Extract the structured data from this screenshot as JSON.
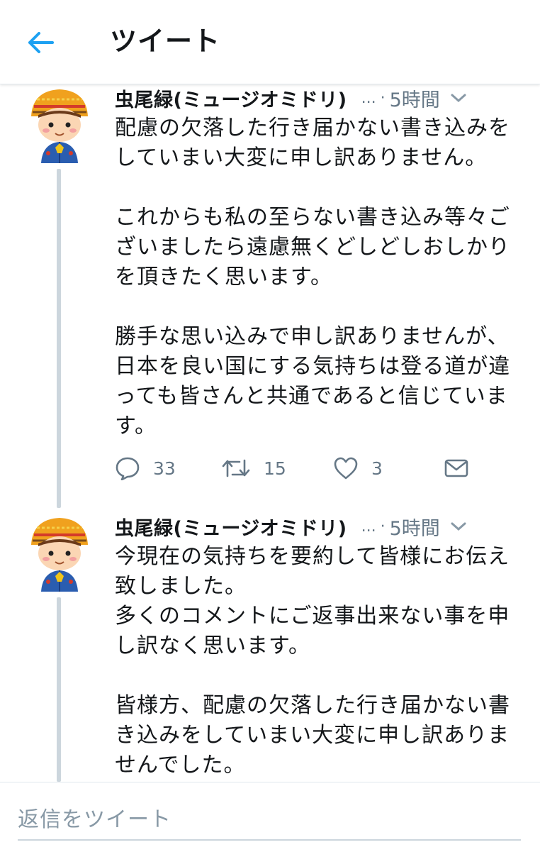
{
  "header": {
    "title": "ツイート"
  },
  "tweets": [
    {
      "author": "虫尾緑(ミュージオミドリ)",
      "ellipsis": "...",
      "separator": "·",
      "time": "5時間",
      "text": "配慮の欠落した行き届かない書き込みを\nしていまい大変に申し訳ありません。\n\nこれからも私の至らない書き込み等々ご\nざいましたら遠慮無くどしどしおしかり\nを頂きたく思います。\n\n勝手な思い込みで申し訳ありませんが、\n日本を良い国にする気持ちは登る道が違\nっても皆さんと共通であると信じていま\nす。",
      "actions": {
        "reply_count": "33",
        "retweet_count": "15",
        "like_count": "3"
      }
    },
    {
      "author": "虫尾緑(ミュージオミドリ)",
      "ellipsis": "...",
      "separator": "·",
      "time": "5時間",
      "text": "今現在の気持ちを要約して皆様にお伝え\n致しました。\n多くのコメントにご返事出来ない事を申\nし訳なく思います。\n\n皆様方、配慮の欠落した行き届かない書\nき込みをしていまい大変に申し訳ありま\nせんでした。"
    }
  ],
  "reply_bar": {
    "placeholder": "返信をツイート"
  },
  "icons": {
    "back": "back-arrow-icon",
    "caret": "chevron-down-icon",
    "reply": "reply-bubble-icon",
    "retweet": "retweet-icon",
    "like": "heart-icon",
    "message": "envelope-icon"
  },
  "colors": {
    "accent": "#1da1f2",
    "text": "#14171a",
    "secondary": "#657786",
    "thread_line": "#ccd6dd"
  }
}
